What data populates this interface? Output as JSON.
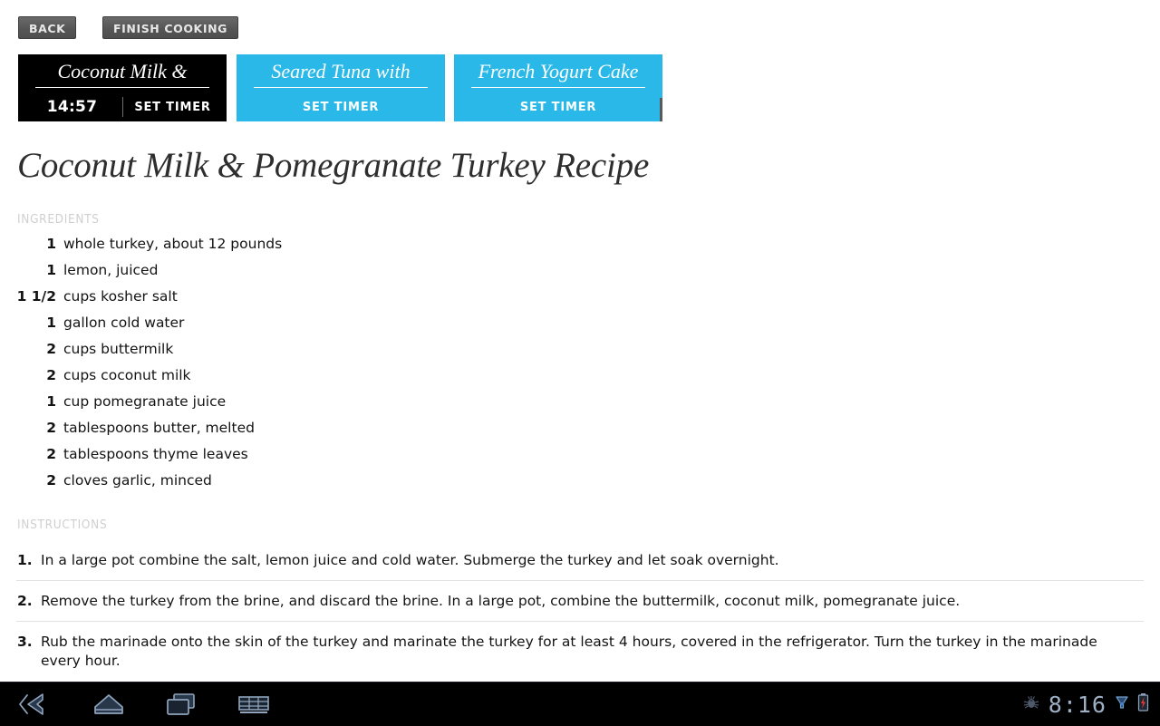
{
  "toolbar": {
    "back_label": "BACK",
    "finish_label": "FINISH COOKING"
  },
  "timer_tabs": [
    {
      "title": "Coconut Milk &",
      "time": "14:57",
      "set_timer_label": "SET TIMER",
      "state": "active",
      "background": "#000000"
    },
    {
      "title": "Seared Tuna with",
      "set_timer_label": "SET TIMER",
      "state": "inactive",
      "background": "#29b8e8"
    },
    {
      "title": "French Yogurt Cake",
      "set_timer_label": "SET TIMER",
      "state": "inactive",
      "background": "#29b8e8"
    }
  ],
  "recipe": {
    "title": "Coconut Milk & Pomegranate Turkey Recipe",
    "ingredients_heading": "INGREDIENTS",
    "instructions_heading": "INSTRUCTIONS",
    "ingredients": [
      {
        "qty": "1",
        "name": "whole turkey, about 12 pounds"
      },
      {
        "qty": "1",
        "name": "lemon, juiced"
      },
      {
        "qty": "1 1/2",
        "name": "cups kosher salt"
      },
      {
        "qty": "1",
        "name": "gallon cold water"
      },
      {
        "qty": "2",
        "name": "cups buttermilk"
      },
      {
        "qty": "2",
        "name": "cups coconut milk"
      },
      {
        "qty": "1",
        "name": "cup pomegranate juice"
      },
      {
        "qty": "2",
        "name": "tablespoons butter, melted"
      },
      {
        "qty": "2",
        "name": "tablespoons thyme leaves"
      },
      {
        "qty": "2",
        "name": "cloves garlic, minced"
      }
    ],
    "instructions": [
      {
        "num": "1.",
        "text": "In a large pot combine the salt, lemon juice and cold water. Submerge the turkey and let soak overnight."
      },
      {
        "num": "2.",
        "text": "Remove the turkey from the brine, and discard the brine. In a large pot, combine the buttermilk, coconut milk, pomegranate juice."
      },
      {
        "num": "3.",
        "text": "Rub the marinade onto the skin of the turkey and marinate the turkey for at least 4 hours, covered in the refrigerator. Turn the turkey in the marinade every hour."
      }
    ]
  },
  "navbar": {
    "icons": [
      "back-icon",
      "home-icon",
      "recent-apps-icon",
      "keyboard-icon"
    ],
    "clock": "8:16",
    "status_icons": [
      "usb-debugging-icon",
      "download-icon",
      "battery-charging-icon"
    ]
  }
}
